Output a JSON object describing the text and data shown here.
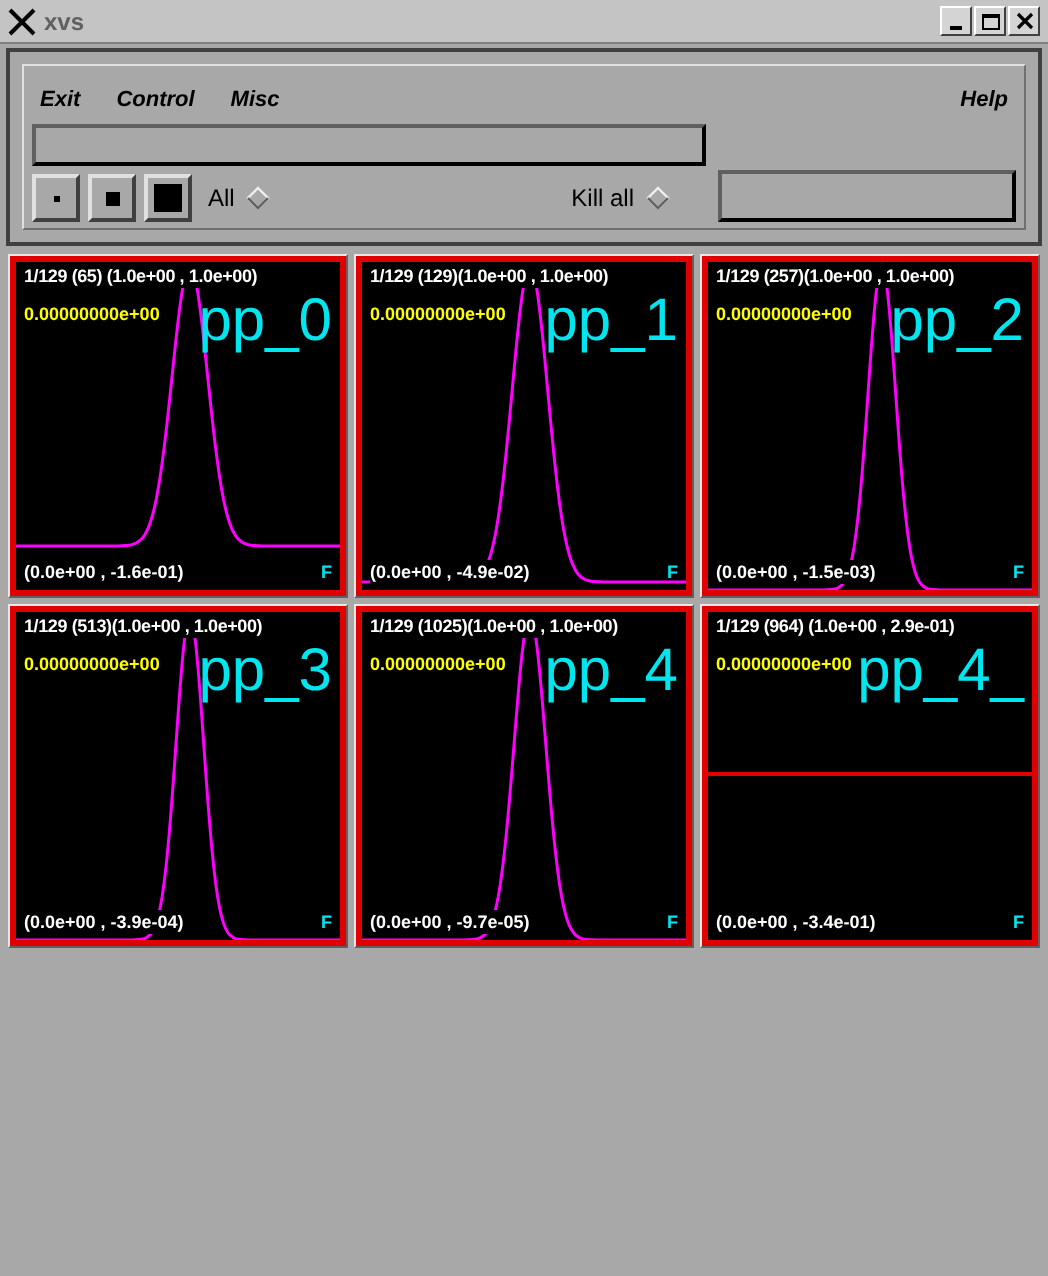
{
  "window": {
    "title": "xvs"
  },
  "menu": [
    {
      "label": "Exit"
    },
    {
      "label": "Control"
    },
    {
      "label": "Misc"
    }
  ],
  "help_menu": {
    "label": "Help"
  },
  "option_menus": [
    {
      "label": "All"
    },
    {
      "label": "Kill all"
    }
  ],
  "panels": [
    {
      "kind": "peak",
      "header": "1/129 (65)  (1.0e+00 , 1.0e+00)",
      "value": "0.00000000e+00",
      "label": "pp_0",
      "coords": "(0.0e+00 , -1.6e-01)",
      "flag": "F"
    },
    {
      "kind": "peak",
      "header": "1/129 (129)(1.0e+00 , 1.0e+00)",
      "value": "0.00000000e+00",
      "label": "pp_1",
      "coords": "(0.0e+00 , -4.9e-02)",
      "flag": "F"
    },
    {
      "kind": "peak",
      "header": "1/129 (257)(1.0e+00 , 1.0e+00)",
      "value": "0.00000000e+00",
      "label": "pp_2",
      "coords": "(0.0e+00 , -1.5e-03)",
      "flag": "F"
    },
    {
      "kind": "peak",
      "header": "1/129 (513)(1.0e+00 , 1.0e+00)",
      "value": "0.00000000e+00",
      "label": "pp_3",
      "coords": "(0.0e+00 , -3.9e-04)",
      "flag": "F"
    },
    {
      "kind": "peak",
      "header": "1/129 (1025)(1.0e+00 , 1.0e+00)",
      "value": "0.00000000e+00",
      "label": "pp_4",
      "coords": "(0.0e+00 , -9.7e-05)",
      "flag": "F"
    },
    {
      "kind": "flat",
      "header": "1/129 (964) (1.0e+00 , 2.9e-01)",
      "value": "0.00000000e+00",
      "label": "pp_4_",
      "coords": "(0.0e+00 , -3.4e-01)",
      "flag": "F"
    }
  ]
}
